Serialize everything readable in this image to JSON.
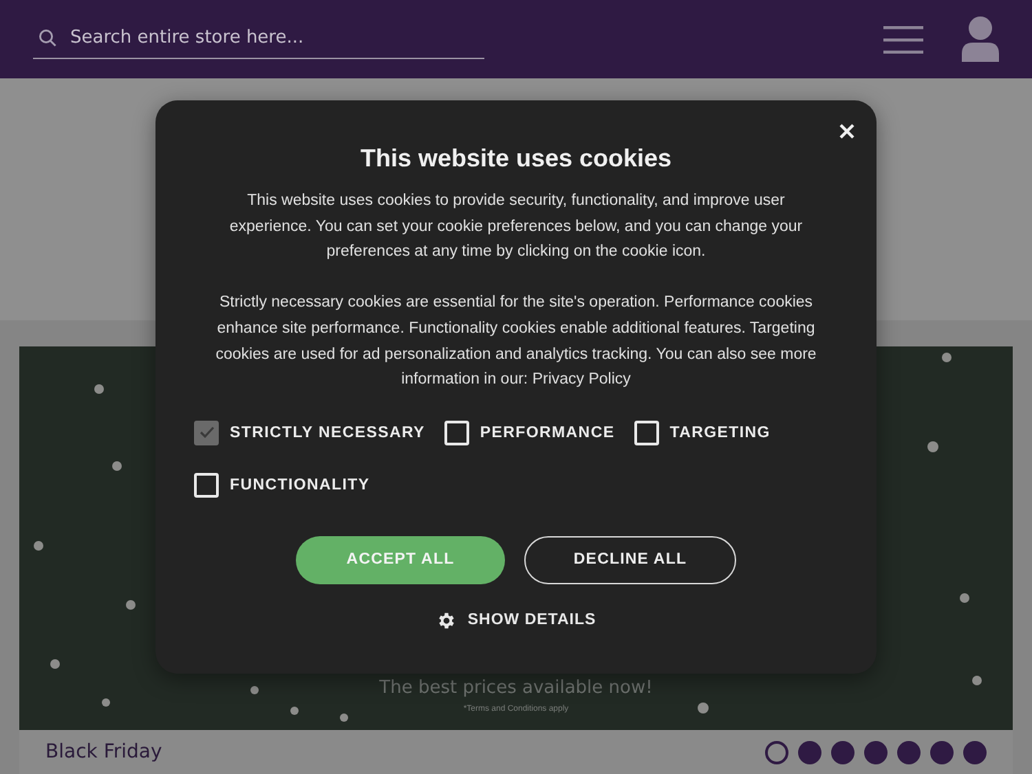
{
  "header": {
    "search": {
      "placeholder": "Search entire store here..."
    }
  },
  "banner": {
    "tagline": "The best prices available now!",
    "terms": "*Terms and Conditions apply"
  },
  "promo_strip": {
    "title": "Black Friday",
    "dots": [
      {
        "selected": true
      },
      {
        "selected": false
      },
      {
        "selected": false
      },
      {
        "selected": false
      },
      {
        "selected": false
      },
      {
        "selected": false
      },
      {
        "selected": false
      }
    ]
  },
  "cookie_dialog": {
    "title": "This website uses cookies",
    "paragraphs": [
      "This website uses cookies to provide security, functionality, and improve user experience. You can set your cookie preferences below, and you can change your preferences at any time by clicking on the cookie icon.",
      "Strictly necessary cookies are essential for the site's operation. Performance cookies enhance site performance. Functionality cookies enable additional features. Targeting cookies are used for ad personalization and analytics tracking. You can also see more information in our: "
    ],
    "privacy_link": "Privacy Policy",
    "options": [
      {
        "label": "STRICTLY NECESSARY",
        "checked": true,
        "disabled": true
      },
      {
        "label": "PERFORMANCE",
        "checked": false,
        "disabled": false
      },
      {
        "label": "TARGETING",
        "checked": false,
        "disabled": false
      },
      {
        "label": "FUNCTIONALITY",
        "checked": false,
        "disabled": false
      }
    ],
    "buttons": [
      {
        "label": "ACCEPT ALL",
        "kind": "primary"
      },
      {
        "label": "DECLINE ALL",
        "kind": "outline"
      }
    ],
    "details_link": "SHOW DETAILS"
  }
}
